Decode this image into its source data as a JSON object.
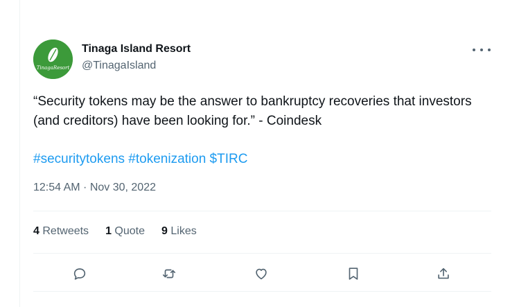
{
  "account": {
    "display_name": "Tinaga Island Resort",
    "handle": "@TinagaIsland",
    "avatar_text": "TinagaResort"
  },
  "tweet": {
    "text": "“Security tokens may be the answer to bankruptcy recoveries that investors (and creditors) have been looking for.” - Coindesk",
    "hashtags": [
      "#securitytokens",
      "#tokenization",
      "$TIRC"
    ],
    "timestamp": "12:54 AM · Nov 30, 2022"
  },
  "stats": {
    "retweets_count": "4",
    "retweets_label": "Retweets",
    "quotes_count": "1",
    "quotes_label": "Quote",
    "likes_count": "9",
    "likes_label": "Likes"
  },
  "actions": [
    "reply-icon",
    "retweet-icon",
    "like-icon",
    "bookmark-icon",
    "share-icon"
  ],
  "colors": {
    "link": "#1d9bf0",
    "secondary_text": "#536471",
    "primary_text": "#0f1419",
    "avatar_bg": "#3c9a3a"
  }
}
